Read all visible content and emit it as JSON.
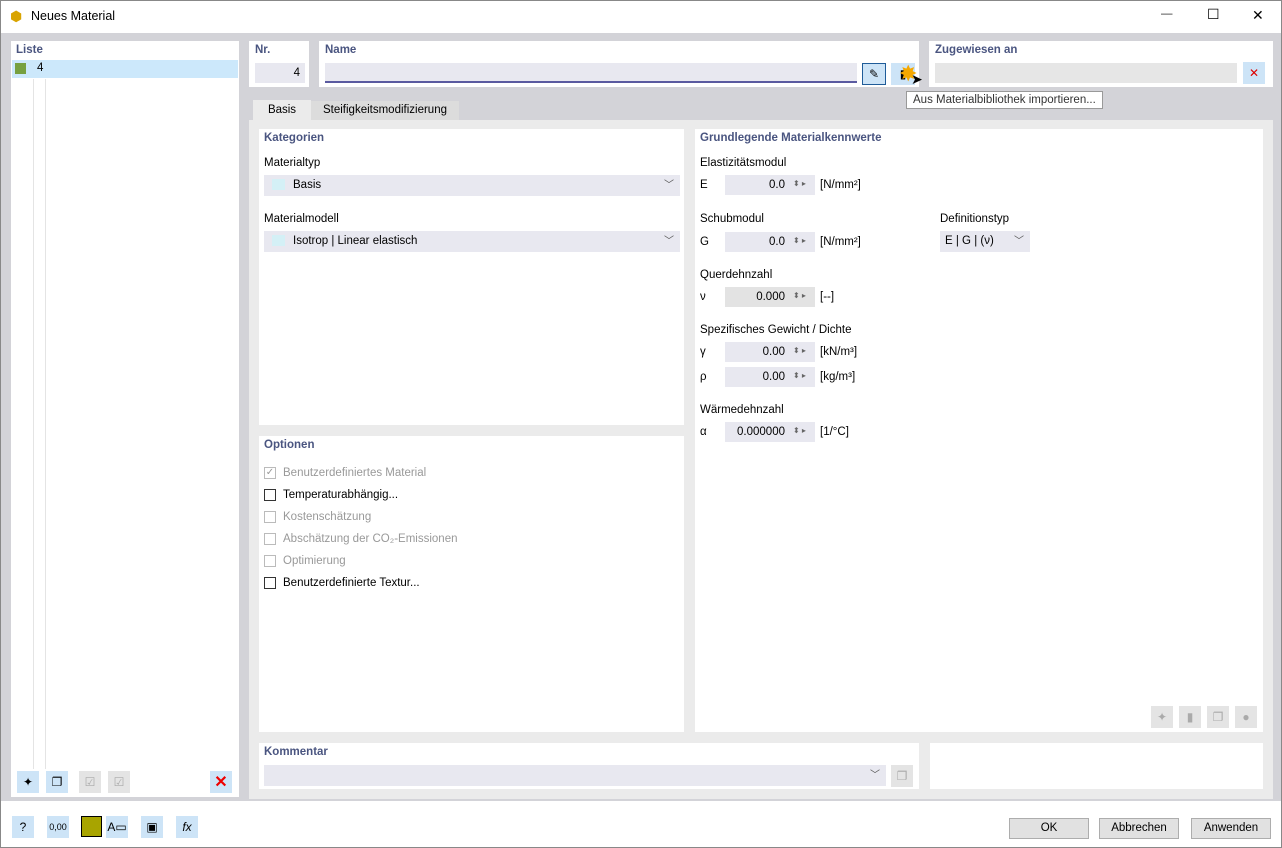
{
  "window": {
    "title": "Neues Material",
    "minimize": "—",
    "maximize": "☐",
    "close": "✕"
  },
  "list": {
    "header": "Liste",
    "items": [
      {
        "label": "4",
        "color": "#77a040"
      }
    ]
  },
  "nr": {
    "label": "Nr.",
    "value": "4"
  },
  "name": {
    "label": "Name",
    "value": ""
  },
  "assigned": {
    "label": "Zugewiesen an",
    "value": ""
  },
  "tooltip": "Aus Materialbibliothek importieren...",
  "tabs": [
    {
      "label": "Basis",
      "active": true
    },
    {
      "label": "Steifigkeitsmodifizierung",
      "active": false
    }
  ],
  "categories": {
    "header": "Kategorien",
    "material_type_label": "Materialtyp",
    "material_type": "Basis",
    "material_model_label": "Materialmodell",
    "material_model": "Isotrop | Linear elastisch"
  },
  "options": {
    "header": "Optionen",
    "items": [
      {
        "label": "Benutzerdefiniertes Material",
        "checked": true,
        "enabled": false
      },
      {
        "label": "Temperaturabhängig...",
        "checked": false,
        "enabled": true
      },
      {
        "label": "Kostenschätzung",
        "checked": false,
        "enabled": false
      },
      {
        "label": "Abschätzung der CO₂-Emissionen",
        "checked": false,
        "enabled": false
      },
      {
        "label": "Optimierung",
        "checked": false,
        "enabled": false
      },
      {
        "label": "Benutzerdefinierte Textur...",
        "checked": false,
        "enabled": true
      }
    ]
  },
  "properties": {
    "header": "Grundlegende Materialkennwerte",
    "e_group": "Elastizitätsmodul",
    "e_sym": "E",
    "e_val": "0.0",
    "e_unit": "[N/mm²]",
    "g_group": "Schubmodul",
    "g_sym": "G",
    "g_val": "0.0",
    "g_unit": "[N/mm²]",
    "def_label": "Definitionstyp",
    "def_val": "E | G | (ν)",
    "nu_group": "Querdehnzahl",
    "nu_sym": "ν",
    "nu_val": "0.000",
    "nu_unit": "[--]",
    "w_group": "Spezifisches Gewicht / Dichte",
    "gamma_sym": "γ",
    "gamma_val": "0.00",
    "gamma_unit": "[kN/m³]",
    "rho_sym": "ρ",
    "rho_val": "0.00",
    "rho_unit": "[kg/m³]",
    "a_group": "Wärmedehnzahl",
    "a_sym": "α",
    "a_val": "0.000000",
    "a_unit": "[1/°C]"
  },
  "comment": {
    "label": "Kommentar",
    "value": ""
  },
  "buttons": {
    "ok": "OK",
    "cancel": "Abbrechen",
    "apply": "Anwenden"
  },
  "bottom_color": "#a8a400"
}
